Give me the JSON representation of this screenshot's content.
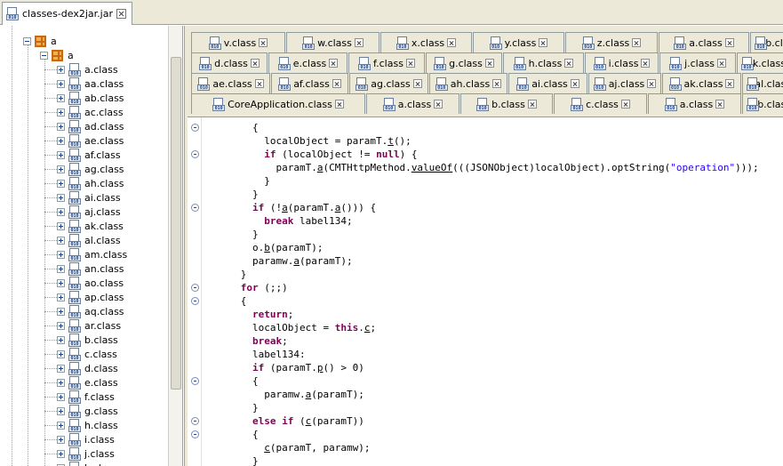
{
  "file_tab": {
    "label": "classes-dex2jar.jar",
    "icon": "jar-file-icon"
  },
  "tree": {
    "root_label": "a",
    "package_label": "a",
    "items": [
      "a.class",
      "aa.class",
      "ab.class",
      "ac.class",
      "ad.class",
      "ae.class",
      "af.class",
      "ag.class",
      "ah.class",
      "ai.class",
      "aj.class",
      "ak.class",
      "al.class",
      "am.class",
      "an.class",
      "ao.class",
      "ap.class",
      "aq.class",
      "ar.class",
      "b.class",
      "c.class",
      "d.class",
      "e.class",
      "f.class",
      "g.class",
      "h.class",
      "i.class",
      "j.class",
      "k.class"
    ]
  },
  "tab_rows": [
    [
      "v.class",
      "w.class",
      "x.class",
      "y.class",
      "z.class",
      "a.class",
      "b.class"
    ],
    [
      "d.class",
      "e.class",
      "f.class",
      "g.class",
      "h.class",
      "i.class",
      "j.class",
      "k.class"
    ],
    [
      "ae.class",
      "af.class",
      "ag.class",
      "ah.class",
      "ai.class",
      "aj.class",
      "ak.class",
      "al.class"
    ],
    [
      "CoreApplication.class",
      "a.class",
      "b.class",
      "c.class",
      "a.class",
      "b.class"
    ]
  ],
  "code_lines": [
    "        {",
    "          localObject = paramT.t();",
    "          if (localObject != null) {",
    "            paramT.a(CMTHttpMethod.valueOf(((JSONObject)localObject).optString(\"operation\")));",
    "          }",
    "        }",
    "        if (!a(paramT.a())) {",
    "          break label134;",
    "        }",
    "        o.b(paramT);",
    "        paramw.a(paramT);",
    "      }",
    "      for (;;)",
    "      {",
    "        return;",
    "        localObject = this.c;",
    "        break;",
    "        label134:",
    "        if (paramT.p() > 0)",
    "        {",
    "          paramw.a(paramT);",
    "        }",
    "        else if (c(paramT))",
    "        {",
    "          c(paramT, paramw);",
    "        }"
  ]
}
